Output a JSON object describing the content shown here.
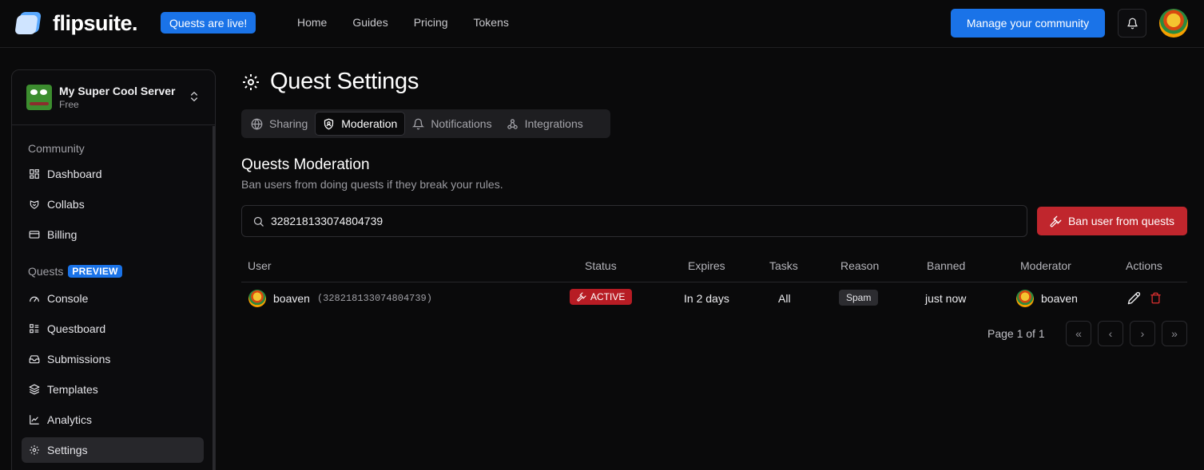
{
  "header": {
    "brand": "flipsuite.",
    "live_badge": "Quests are live!",
    "nav": [
      "Home",
      "Guides",
      "Pricing",
      "Tokens"
    ],
    "manage_button": "Manage your community"
  },
  "sidebar": {
    "server_name": "My Super Cool Server",
    "server_plan": "Free",
    "community_label": "Community",
    "community_items": [
      "Dashboard",
      "Collabs",
      "Billing"
    ],
    "quests_label": "Quests",
    "quests_badge": "PREVIEW",
    "quests_items": [
      "Console",
      "Questboard",
      "Submissions",
      "Templates",
      "Analytics",
      "Settings"
    ],
    "active_item": "Settings"
  },
  "main": {
    "title": "Quest Settings",
    "tabs": [
      {
        "label": "Sharing",
        "icon": "globe-icon"
      },
      {
        "label": "Moderation",
        "icon": "shield-icon"
      },
      {
        "label": "Notifications",
        "icon": "bell-icon"
      },
      {
        "label": "Integrations",
        "icon": "webhook-icon"
      }
    ],
    "active_tab": "Moderation",
    "section_title": "Quests Moderation",
    "section_subtitle": "Ban users from doing quests if they break your rules.",
    "search_value": "328218133074804739",
    "ban_button": "Ban user from quests"
  },
  "table": {
    "columns": [
      "User",
      "Status",
      "Expires",
      "Tasks",
      "Reason",
      "Banned",
      "Moderator",
      "Actions"
    ],
    "rows": [
      {
        "user": "boaven",
        "user_id": "(328218133074804739)",
        "status": "ACTIVE",
        "expires": "In 2 days",
        "tasks": "All",
        "reason": "Spam",
        "banned": "just now",
        "moderator": "boaven"
      }
    ]
  },
  "pagination": {
    "label": "Page 1 of 1",
    "buttons": [
      "«",
      "‹",
      "›",
      "»"
    ]
  },
  "colors": {
    "accent": "#1a73e8",
    "danger": "#c0262d",
    "background": "#0a0a0b"
  }
}
